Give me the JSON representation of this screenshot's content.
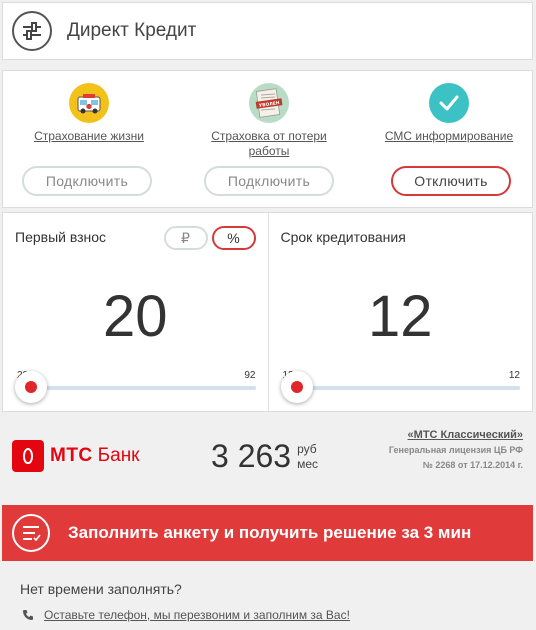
{
  "header": {
    "title": "Директ Кредит",
    "settings_icon": "sliders-icon"
  },
  "options": [
    {
      "label": "Страхование жизни",
      "button": "Подключить",
      "active": false,
      "icon": "ambulance-icon"
    },
    {
      "label": "Страховка от потери работы",
      "button": "Подключить",
      "active": false,
      "icon": "dismissal-doc-icon",
      "icon_badge": "УВОЛЕН"
    },
    {
      "label": "СМС информирование",
      "button": "Отключить",
      "active": true,
      "icon": "check-icon"
    }
  ],
  "down_payment": {
    "label": "Первый взнос",
    "units": [
      "₽",
      "%"
    ],
    "selected_unit": "%",
    "value": "20",
    "min": "20",
    "max": "92"
  },
  "term": {
    "label": "Срок кредитования",
    "value": "12",
    "min": "12",
    "max": "12"
  },
  "bank": {
    "name_bold": "МТС",
    "name": "Банк",
    "payment": "3 263",
    "payment_unit_1": "руб",
    "payment_unit_2": "мес",
    "product": "«МТС Классический»",
    "license_1": "Генеральная лицензия ЦБ РФ",
    "license_2": "№ 2268 от 17.12.2014 г."
  },
  "cta": {
    "label": "Заполнить анкету и получить решение за 3 мин"
  },
  "footer": {
    "no_time": "Нет времени заполнять?",
    "callback": "Оставьте телефон, мы перезвоним и заполним за Вас!"
  },
  "colors": {
    "accent": "#e03a3a",
    "mts_red": "#e30611",
    "teal": "#3cc2c4"
  }
}
